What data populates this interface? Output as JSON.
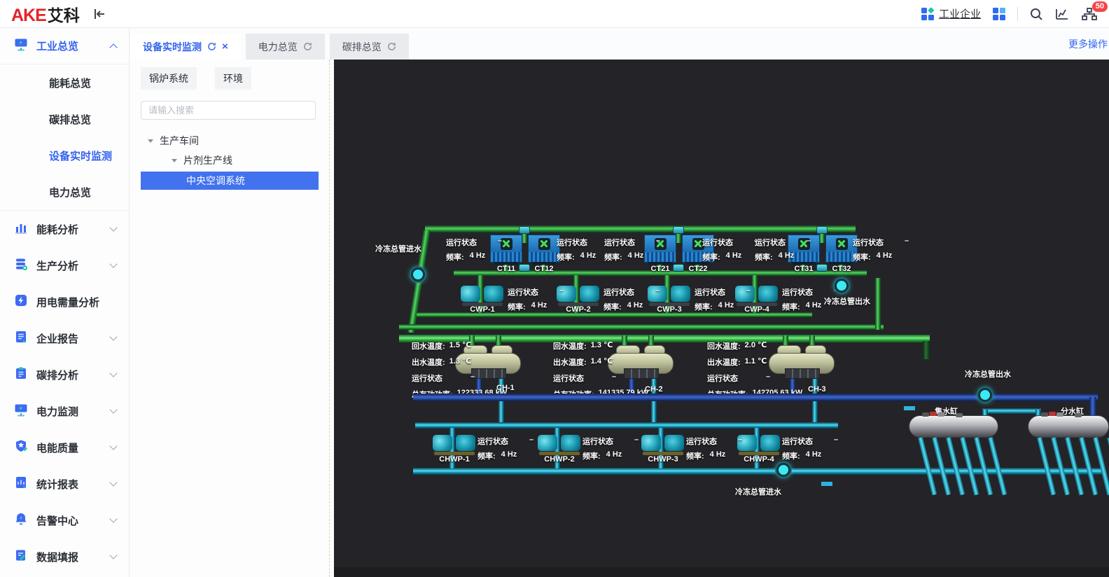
{
  "header": {
    "logo_red": "AKE",
    "logo_black": "艾科",
    "org_link": "工业企业",
    "badge_count": "50"
  },
  "tabs": {
    "items": [
      {
        "label": "设备实时监测",
        "active": true,
        "closable": true
      },
      {
        "label": "电力总览",
        "active": false
      },
      {
        "label": "碳排总览",
        "active": false
      }
    ],
    "more_label": "更多操作"
  },
  "panel": {
    "chips": [
      "锅炉系统",
      "环境"
    ],
    "search_placeholder": "请输入搜索",
    "tree": {
      "root": "生产车间",
      "child": "片剂生产线",
      "selected": "中央空调系统"
    }
  },
  "sidebar": {
    "items": [
      {
        "label": "工业总览",
        "icon": "monitor-icon",
        "expanded": true,
        "active": true
      },
      {
        "label": "能耗总览",
        "sub": true
      },
      {
        "label": "碳排总览",
        "sub": true
      },
      {
        "label": "设备实时监测",
        "sub": true,
        "selected": true
      },
      {
        "label": "电力总览",
        "sub": true
      },
      {
        "label": "能耗分析",
        "icon": "bar-chart-icon",
        "collapsible": true
      },
      {
        "label": "生产分析",
        "icon": "database-icon",
        "collapsible": true
      },
      {
        "label": "用电需量分析",
        "icon": "bolt-icon"
      },
      {
        "label": "企业报告",
        "icon": "document-icon",
        "collapsible": true
      },
      {
        "label": "碳排分析",
        "icon": "clipboard-icon",
        "collapsible": true
      },
      {
        "label": "电力监测",
        "icon": "monitor-icon",
        "collapsible": true
      },
      {
        "label": "电能质量",
        "icon": "shield-icon",
        "collapsible": true
      },
      {
        "label": "统计报表",
        "icon": "report-icon",
        "collapsible": true
      },
      {
        "label": "告警中心",
        "icon": "bell-icon",
        "collapsible": true
      },
      {
        "label": "数据填报",
        "icon": "edit-icon",
        "collapsible": true
      }
    ]
  },
  "scada": {
    "labels": {
      "pipe_in": "冷冻总管进水",
      "pipe_out": "冷冻总管出水",
      "status": "运行状态",
      "status_value": "–",
      "freq": "频率:",
      "freq_value": "4 Hz"
    },
    "towers": [
      "CT11",
      "CT12",
      "CT21",
      "CT22",
      "CT31",
      "CT32"
    ],
    "cwp": [
      "CWP-1",
      "CWP-2",
      "CWP-3",
      "CWP-4"
    ],
    "chwp": [
      "CHWP-1",
      "CHWP-2",
      "CHWP-3",
      "CHWP-4"
    ],
    "chiller_labels": {
      "return": "回水温度:",
      "supply": "出水温度:",
      "status": "运行状态",
      "power": "总有功功率:"
    },
    "chillers": [
      {
        "id": "CH-1",
        "return": "1.5 ℃",
        "supply": "1.3 ℃",
        "status": "–",
        "power": "122333.68 kW"
      },
      {
        "id": "CH-2",
        "return": "1.3 ℃",
        "supply": "1.4 ℃",
        "status": "–",
        "power": "141335.79 kW"
      },
      {
        "id": "CH-3",
        "return": "2.0 ℃",
        "supply": "1.1 ℃",
        "status": "–",
        "power": "142705.63 kW"
      }
    ],
    "tanks": {
      "collector": "集水缸",
      "distributor": "分水缸"
    },
    "colors": {
      "canvas_bg": "#242428",
      "pipe_green": "#55d863",
      "pipe_cyan": "#52dff6",
      "pipe_blue": "#3c68d0",
      "valve_cyan": "#3be9f2",
      "accent_blue": "#3564ed"
    }
  }
}
